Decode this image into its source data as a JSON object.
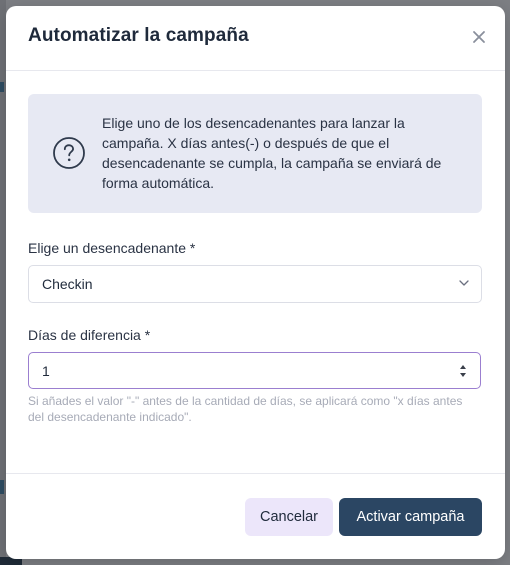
{
  "modal": {
    "title": "Automatizar la campaña",
    "close_icon": "close-icon"
  },
  "info": {
    "icon": "question-circle-icon",
    "text": "Elige uno de los desencadenantes para lanzar la campaña. X días antes(-) o después de que el desencadenante se cumpla, la campaña se enviará de forma automática."
  },
  "trigger_field": {
    "label": "Elige un desencadenante *",
    "selected": "Checkin",
    "icon": "chevron-down-icon"
  },
  "days_field": {
    "label": "Días de diferencia *",
    "value": "1",
    "help": "Si añades el valor \"-\" antes de la cantidad de días, se aplicará como \"x días antes del desencadenante indicado\"."
  },
  "footer": {
    "cancel_label": "Cancelar",
    "activate_label": "Activar campaña"
  },
  "colors": {
    "primary": "#2b4663",
    "cancel_bg": "#ece6fa",
    "info_bg": "#e7e9f3",
    "focus_border": "#9b7fd0"
  }
}
